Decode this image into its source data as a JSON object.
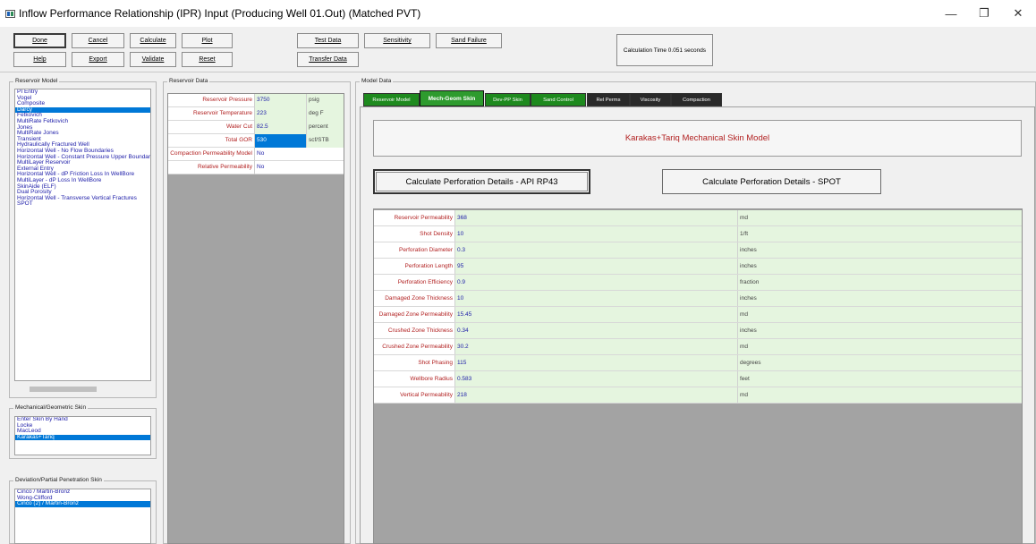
{
  "window": {
    "title": "Inflow Performance Relationship (IPR) Input (Producing Well 01.Out) (Matched PVT)",
    "controls": [
      "—",
      "❐",
      "✕"
    ]
  },
  "toolbar": {
    "done": "Done",
    "cancel": "Cancel",
    "calculate": "Calculate",
    "plot": "Plot",
    "test_data": "Test Data",
    "sensitivity": "Sensitivity",
    "sand_failure": "Sand Failure",
    "help": "Help",
    "export": "Export",
    "validate": "Validate",
    "reset": "Reset",
    "transfer_data": "Transfer Data",
    "calc_time": "Calculation Time 0.051 seconds"
  },
  "reservoir_model": {
    "label": "Reservoir Model",
    "items": [
      "PI Entry",
      "Vogel",
      "Composite",
      "Darcy",
      "Fetkovich",
      "MultiRate Fetkovich",
      "Jones",
      "MultiRate Jones",
      "Transient",
      "Hydraulically Fractured Well",
      "Horizontal Well - No Flow Boundaries",
      "Horizontal Well - Constant Pressure Upper Boundary",
      "MultiLayer Reservoir",
      "External Entry",
      "Horizontal Well - dP Friction Loss In WellBore",
      "MultiLayer - dP Loss In WellBore",
      "SkinAide (ELF)",
      "Dual Porosity",
      "Horizontal Well - Transverse Vertical Fractures",
      "SPOT"
    ],
    "selected_index": 3
  },
  "mech_skin": {
    "label": "Mechanical/Geometric Skin",
    "items": [
      "Enter Skin By Hand",
      "Locke",
      "MacLeod",
      "Karakas+Tariq"
    ],
    "selected_index": 3
  },
  "dev_skin": {
    "label": "Deviation/Partial Penetration Skin",
    "items": [
      "Cinco / Martin-Bronz",
      "Wong-Clifford",
      "Cinco (2) / Martin-Bronz"
    ],
    "selected_index": 2
  },
  "reservoir_data": {
    "label": "Reservoir Data",
    "rows": [
      {
        "label": "Reservoir Pressure",
        "value": "3750",
        "unit": "psig"
      },
      {
        "label": "Reservoir Temperature",
        "value": "223",
        "unit": "deg F"
      },
      {
        "label": "Water Cut",
        "value": "82.5",
        "unit": "percent"
      },
      {
        "label": "Total GOR",
        "value": "530",
        "unit": "scf/STB"
      },
      {
        "label": "Compaction Permeability Model",
        "value": "No",
        "unit": ""
      },
      {
        "label": "Relative Permeability",
        "value": "No",
        "unit": ""
      }
    ]
  },
  "model_data": {
    "label": "Model Data",
    "tabs": [
      "Reservoir Model",
      "Mech-Geom Skin",
      "Dev-PP Skin",
      "Sand Control",
      "Rel Perms",
      "Viscosity",
      "Compaction"
    ],
    "active_tab": 1,
    "model_title": "Karakas+Tariq Mechanical Skin Model",
    "btn_api": "Calculate Perforation Details - API RP43",
    "btn_spot": "Calculate Perforation Details - SPOT",
    "rows": [
      {
        "label": "Reservoir Permeability",
        "value": "368",
        "unit": "md"
      },
      {
        "label": "Shot Density",
        "value": "10",
        "unit": "1/ft"
      },
      {
        "label": "Perforation Diameter",
        "value": "0.3",
        "unit": "inches"
      },
      {
        "label": "Perforation Length",
        "value": "95",
        "unit": "inches"
      },
      {
        "label": "Perforation Efficiency",
        "value": "0.9",
        "unit": "fraction"
      },
      {
        "label": "Damaged Zone Thickness",
        "value": "10",
        "unit": "inches"
      },
      {
        "label": "Damaged Zone Permeability",
        "value": "15.45",
        "unit": "md"
      },
      {
        "label": "Crushed Zone Thickness",
        "value": "0.34",
        "unit": "inches"
      },
      {
        "label": "Crushed Zone Permeability",
        "value": "30.2",
        "unit": "md"
      },
      {
        "label": "Shot Phasing",
        "value": "115",
        "unit": "degrees"
      },
      {
        "label": "Wellbore Radius",
        "value": "0.583",
        "unit": "feet"
      },
      {
        "label": "Vertical Permeability",
        "value": "218",
        "unit": "md"
      }
    ]
  }
}
